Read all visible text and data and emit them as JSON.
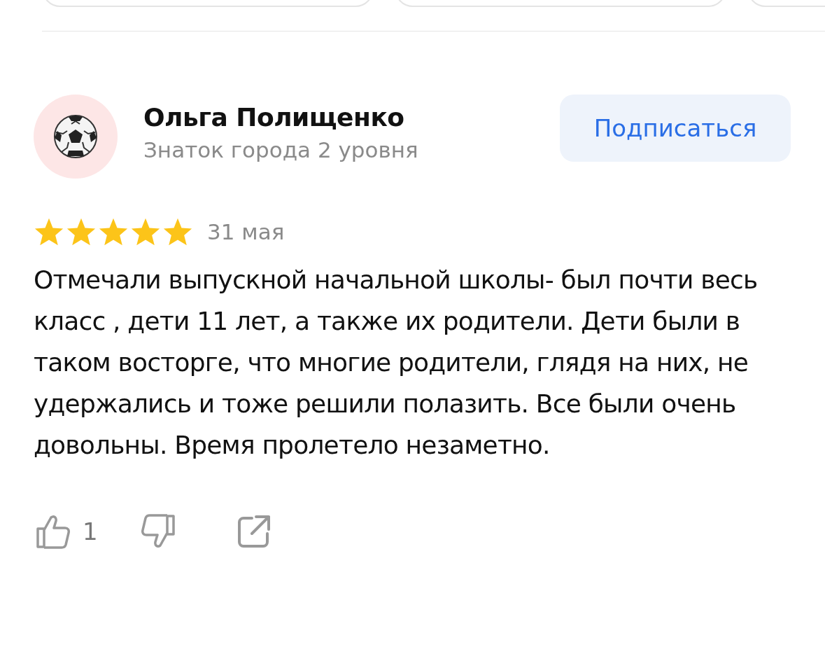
{
  "review": {
    "author": "Ольга Полищенко",
    "author_level": "Знаток города 2 уровня",
    "subscribe_button": "Подписаться",
    "stars": 5,
    "date": "31 мая",
    "text": "Отмечали выпускной начальной школы- был почти весь класс , дети 11 лет, а также их родители. Дети были в таком восторге, что многие родители, глядя на них, не удержались и тоже решили полазить. Все были очень довольны. Время пролетело незаметно.",
    "likes": "1"
  }
}
